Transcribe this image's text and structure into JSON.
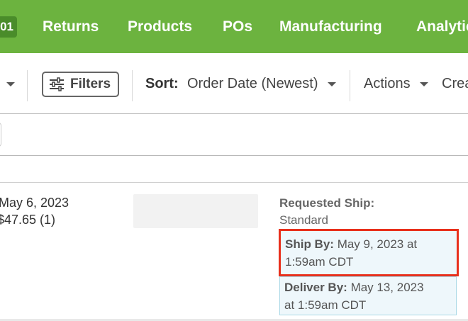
{
  "nav": {
    "badge": "01",
    "items": [
      "Returns",
      "Products",
      "POs",
      "Manufacturing",
      "Analytics"
    ]
  },
  "toolbar": {
    "filters_label": "Filters",
    "sort_label": "Sort:",
    "sort_value": "Order Date (Newest)",
    "actions_label": "Actions",
    "create_label": "Create"
  },
  "order": {
    "date": "May 6, 2023",
    "total": "$47.65 (1)",
    "requested_ship_label": "Requested Ship:",
    "requested_ship_value": "Standard",
    "ship_by_label": "Ship By:",
    "ship_by_value_line1": "May 9, 2023 at",
    "ship_by_value_line2": "1:59am CDT",
    "deliver_by_label": "Deliver By:",
    "deliver_by_value_line1": "May 13, 2023",
    "deliver_by_value_line2": "at 1:59am CDT"
  },
  "colors": {
    "nav_bg": "#6cb33f",
    "badge_bg": "#4a8c2a",
    "highlight_border": "#e8301c",
    "info_bg": "#eef7fb"
  }
}
